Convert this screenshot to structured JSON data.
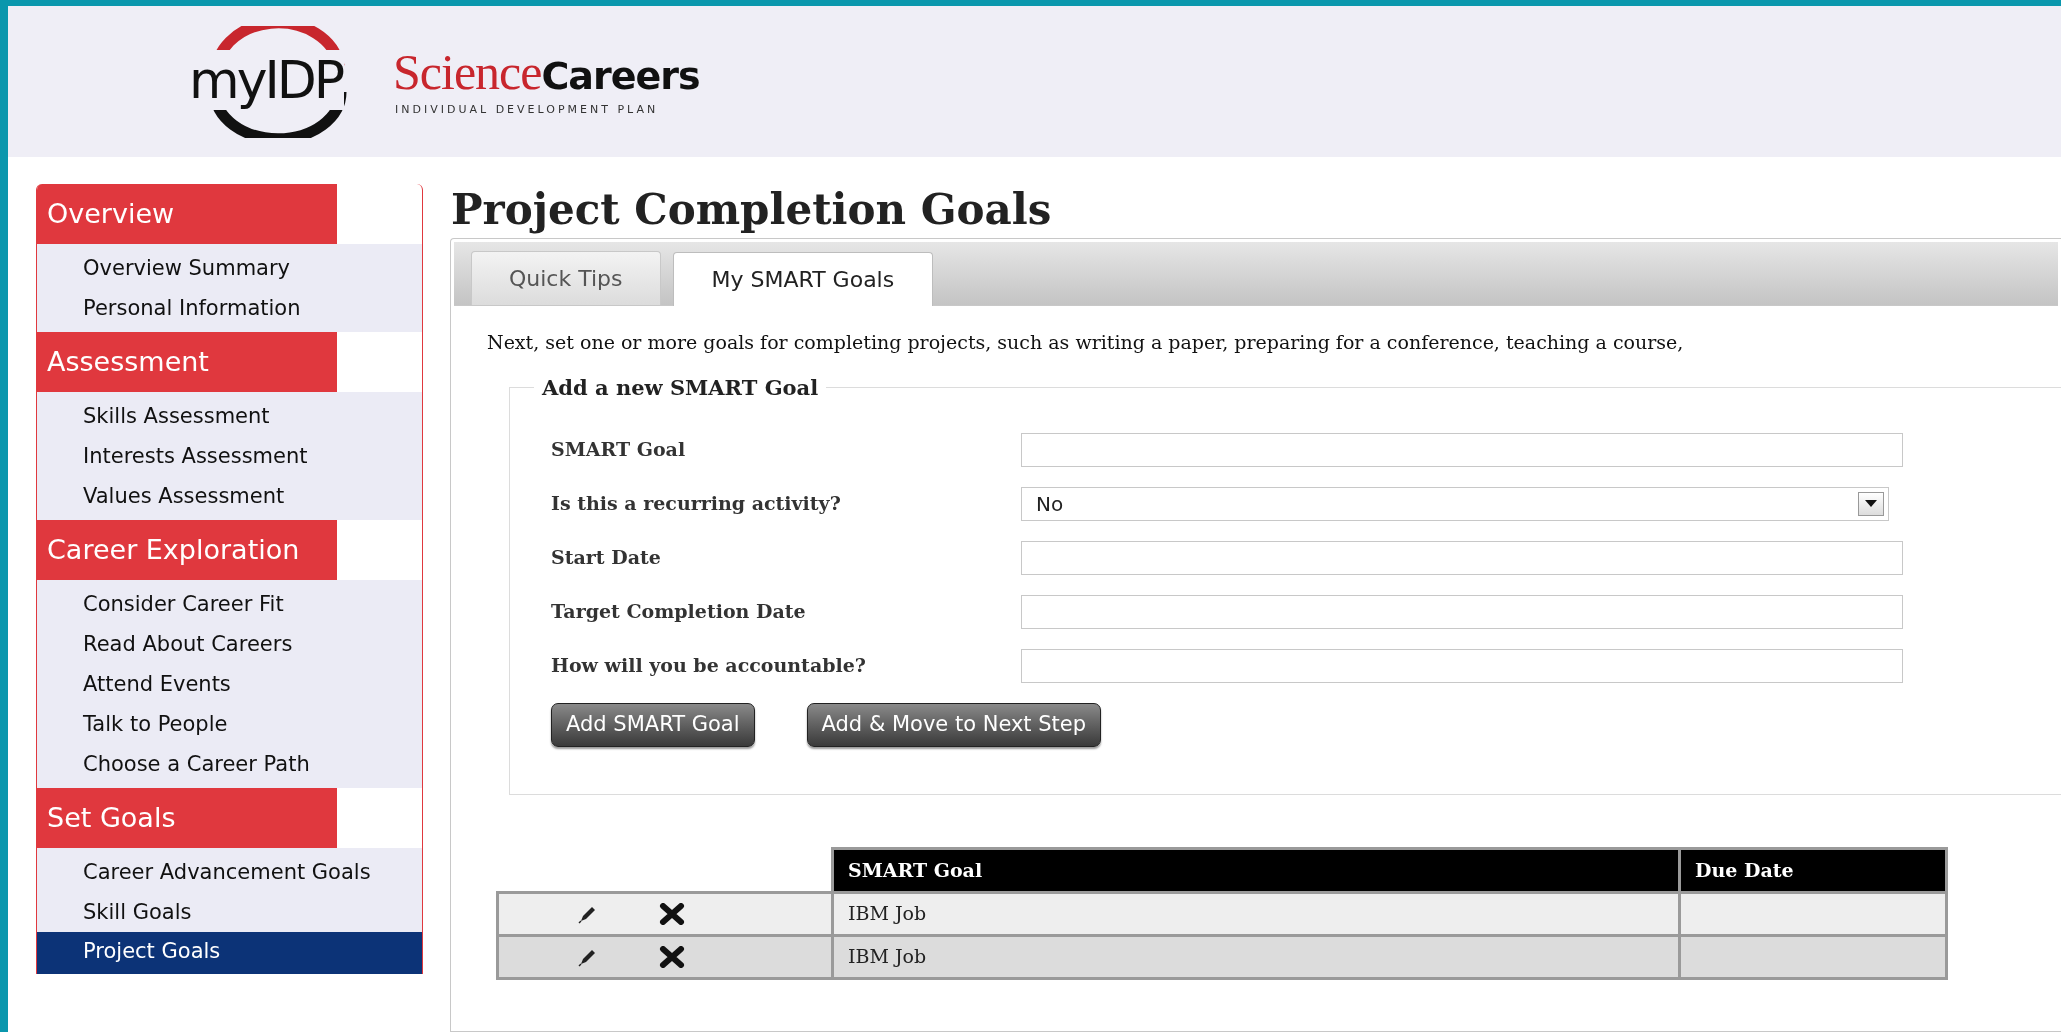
{
  "header": {
    "logo_text": "myIDP",
    "brand": {
      "science": "Science",
      "careers": "Careers",
      "tagline": "INDIVIDUAL DEVELOPMENT PLAN"
    }
  },
  "sidebar": {
    "sections": [
      {
        "title": "Overview",
        "items": [
          {
            "label": "Overview Summary",
            "selected": false
          },
          {
            "label": "Personal Information",
            "selected": false
          }
        ]
      },
      {
        "title": "Assessment",
        "items": [
          {
            "label": "Skills Assessment",
            "selected": false
          },
          {
            "label": "Interests Assessment",
            "selected": false
          },
          {
            "label": "Values Assessment",
            "selected": false
          }
        ]
      },
      {
        "title": "Career Exploration",
        "items": [
          {
            "label": "Consider Career Fit",
            "selected": false
          },
          {
            "label": "Read About Careers",
            "selected": false
          },
          {
            "label": "Attend Events",
            "selected": false
          },
          {
            "label": "Talk to People",
            "selected": false
          },
          {
            "label": "Choose a Career Path",
            "selected": false
          }
        ]
      },
      {
        "title": "Set Goals",
        "items": [
          {
            "label": "Career Advancement Goals",
            "selected": false
          },
          {
            "label": "Skill Goals",
            "selected": false
          },
          {
            "label": "Project Goals",
            "selected": true
          }
        ]
      }
    ]
  },
  "page_title": "Project Completion Goals",
  "tabs": [
    {
      "label": "Quick Tips",
      "selected": false
    },
    {
      "label": "My SMART Goals",
      "selected": true
    }
  ],
  "intro": "Next, set one or more goals for completing projects, such as writing a paper, preparing for a conference, teaching a course,",
  "form": {
    "legend": "Add a new SMART Goal",
    "fields": [
      {
        "label": "SMART Goal",
        "kind": "text"
      },
      {
        "label": "Is this a recurring activity?",
        "kind": "select",
        "value": "No"
      },
      {
        "label": "Start Date",
        "kind": "text"
      },
      {
        "label": "Target Completion Date",
        "kind": "text"
      },
      {
        "label": "How will you be accountable?",
        "kind": "text"
      }
    ],
    "buttons": [
      "Add SMART Goal",
      "Add & Move to Next Step"
    ]
  },
  "table": {
    "columns": [
      "SMART Goal",
      "Due Date"
    ],
    "rows": [
      {
        "goal": "IBM Job"
      },
      {
        "goal": "IBM Job"
      }
    ]
  }
}
